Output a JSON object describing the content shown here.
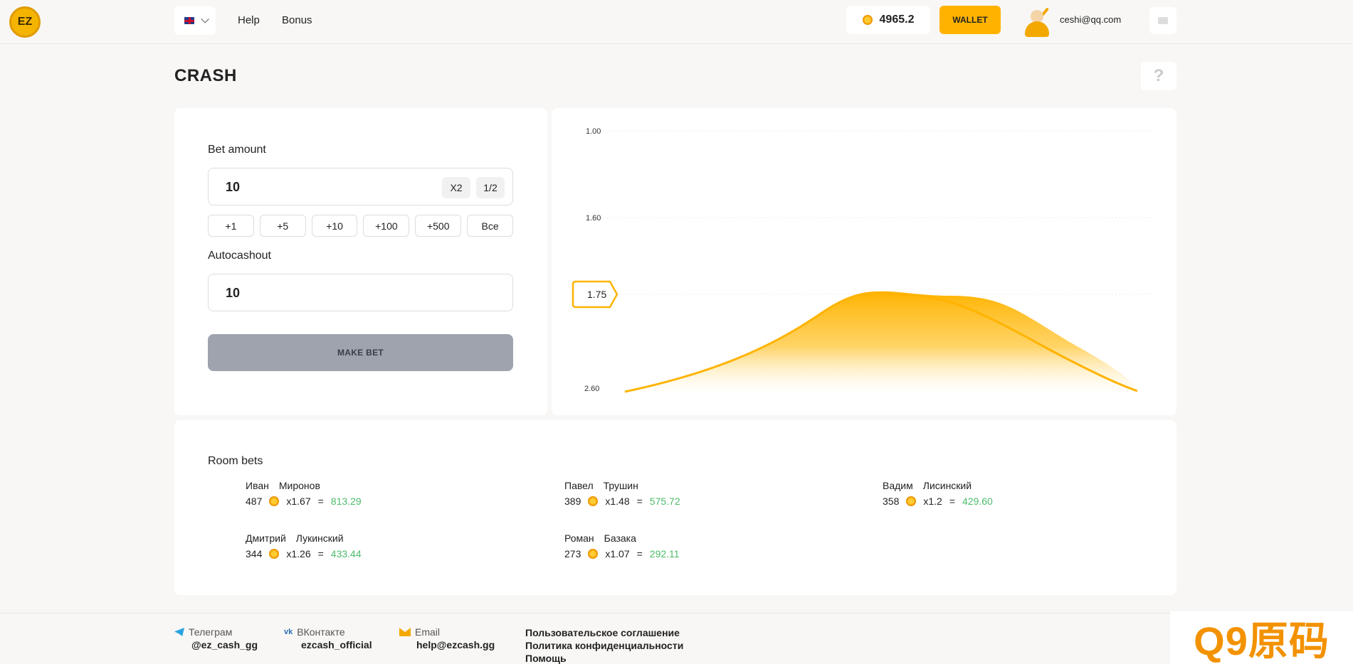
{
  "header": {
    "logo_text": "EZ",
    "nav": [
      {
        "label": "Help"
      },
      {
        "label": "Bonus"
      }
    ],
    "balance": "4965.2",
    "wallet_label": "WALLET",
    "user_email": "ceshi@qq.com"
  },
  "page": {
    "title": "CRASH",
    "help_symbol": "?"
  },
  "bet_form": {
    "bet_amount_label": "Bet amount",
    "bet_amount_value": "10",
    "double_label": "X2",
    "half_label": "1/2",
    "quick_adds": [
      "+1",
      "+5",
      "+10",
      "+100",
      "+500",
      "Все"
    ],
    "autocashout_label": "Autocashout",
    "autocashout_value": "10",
    "make_bet_label": "MAKE BET"
  },
  "chart_data": {
    "type": "area",
    "y_ticks": [
      "1.00",
      "1.60",
      "2.60"
    ],
    "current_multiplier": "1.75",
    "line_color": "#ffb300"
  },
  "room_bets": {
    "title": "Room bets",
    "entries": [
      {
        "first": "Иван",
        "last": "Миронов",
        "amount": "487",
        "mult": "x1.67",
        "eq": "=",
        "win": "813.29"
      },
      {
        "first": "Павел",
        "last": "Трушин",
        "amount": "389",
        "mult": "x1.48",
        "eq": "=",
        "win": "575.72"
      },
      {
        "first": "Вадим",
        "last": "Лисинский",
        "amount": "358",
        "mult": "x1.2",
        "eq": "=",
        "win": "429.60"
      },
      {
        "first": "Дмитрий",
        "last": "Лукинский",
        "amount": "344",
        "mult": "x1.26",
        "eq": "=",
        "win": "433.44"
      },
      {
        "first": "Роман",
        "last": "Базака",
        "amount": "273",
        "mult": "x1.07",
        "eq": "=",
        "win": "292.11"
      }
    ]
  },
  "footer": {
    "telegram": {
      "label": "Телеграм",
      "value": "@ez_cash_gg"
    },
    "vk": {
      "label": "ВКонтакте",
      "value": "ezcash_official",
      "icon_text": "vk"
    },
    "email": {
      "label": "Email",
      "value": "help@ezcash.gg"
    },
    "links": [
      "Пользовательское соглашение",
      "Политика конфиденциальности",
      "Помощь"
    ]
  },
  "watermark": "Q9原码"
}
